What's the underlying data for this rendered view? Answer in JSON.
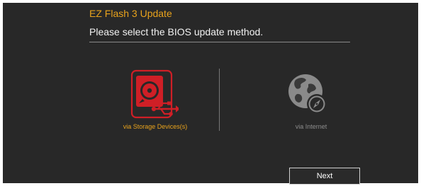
{
  "header": {
    "title": "EZ Flash 3 Update",
    "prompt": "Please select the BIOS update method."
  },
  "options": [
    {
      "label": "via Storage Devices(s)",
      "icon": "storage-usb-icon",
      "selected": true
    },
    {
      "label": "via Internet",
      "icon": "globe-icon",
      "selected": false
    }
  ],
  "footer": {
    "next_label": "Next"
  },
  "colors": {
    "background": "#282828",
    "accent": "#e8a21c",
    "storage_red": "#cf1f26",
    "disabled_gray": "#8c8c8c",
    "text": "#f2f2f2"
  }
}
